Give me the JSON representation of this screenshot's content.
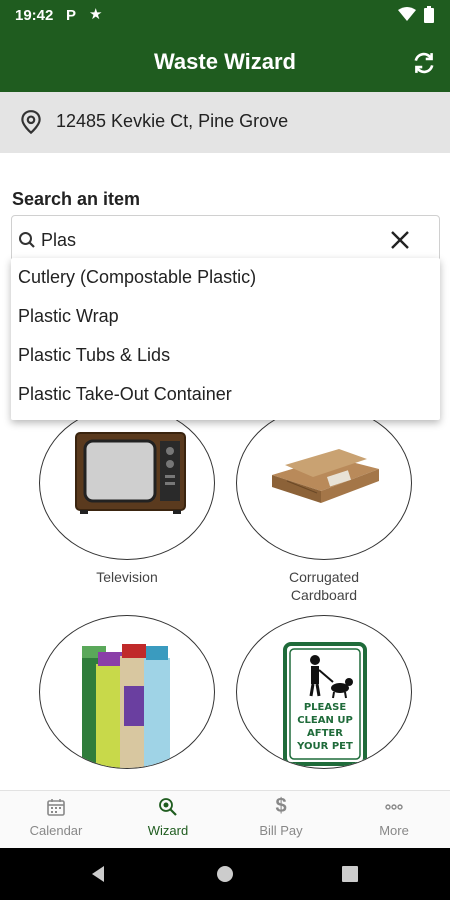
{
  "status_bar": {
    "time": "19:42",
    "app_badge": "P"
  },
  "app_bar": {
    "title": "Waste Wizard"
  },
  "location": {
    "address": "12485 Kevkie Ct, Pine Grove"
  },
  "search": {
    "label": "Search an item",
    "value": "Plas",
    "suggestions": [
      "Cutlery (Compostable Plastic)",
      "Plastic Wrap",
      "Plastic Tubs & Lids",
      "Plastic Take-Out Container"
    ]
  },
  "items": [
    {
      "label": "Television"
    },
    {
      "label": "Corrugated\nCardboard"
    },
    {
      "label": ""
    },
    {
      "label": ""
    }
  ],
  "pet_sign": {
    "lines": [
      "PLEASE",
      "CLEAN UP",
      "AFTER",
      "YOUR PET"
    ]
  },
  "bottom_nav": [
    {
      "label": "Calendar",
      "icon": "calendar-icon"
    },
    {
      "label": "Wizard",
      "icon": "wizard-icon",
      "active": true
    },
    {
      "label": "Bill Pay",
      "icon": "dollar-icon"
    },
    {
      "label": "More",
      "icon": "more-icon"
    }
  ],
  "colors": {
    "primary": "#1f5c1f",
    "nav_inactive": "#888888",
    "address_bg": "#e4e4e4"
  }
}
